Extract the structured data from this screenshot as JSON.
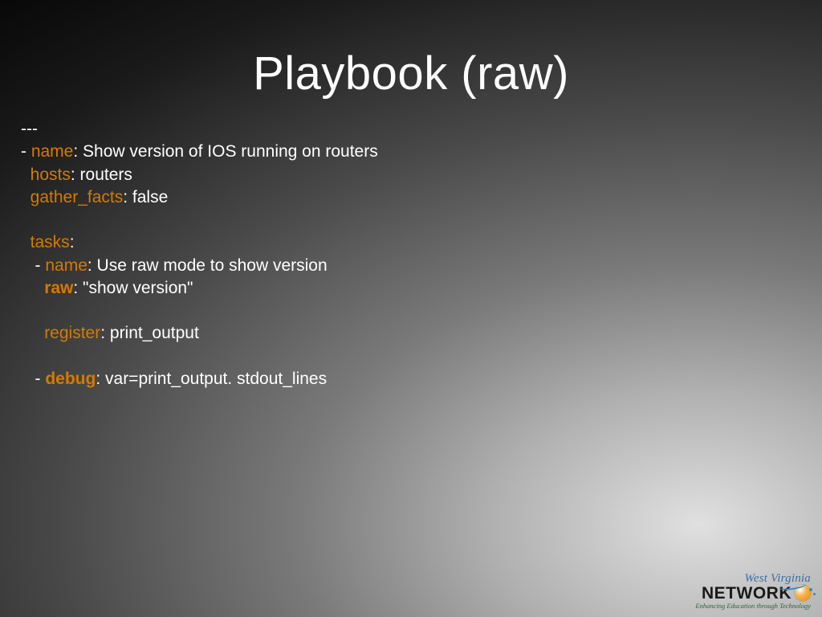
{
  "title": "Playbook (raw)",
  "yaml": {
    "doc_start": "---",
    "play_dash": "- ",
    "name_key": "name",
    "name_val": ": Show version of IOS running on routers",
    "hosts_key": "hosts",
    "hosts_val": ": routers",
    "gather_key": "gather_facts",
    "gather_val": ": false",
    "tasks_key": "tasks",
    "tasks_colon": ":",
    "t1_dash": "   - ",
    "t1_name_key": "name",
    "t1_name_val": ": Use raw mode to show version",
    "t1_raw_key": "raw",
    "t1_raw_val": ": \"show version\"",
    "t1_reg_key": "register",
    "t1_reg_val": ": print_output",
    "t2_dash": "   - ",
    "t2_debug_key": "debug",
    "t2_debug_val": ": var=print_output. stdout_lines"
  },
  "logo": {
    "line1": "West Virginia",
    "line2": "NETWORK",
    "tagline": "Enhancing Education through Technology"
  }
}
